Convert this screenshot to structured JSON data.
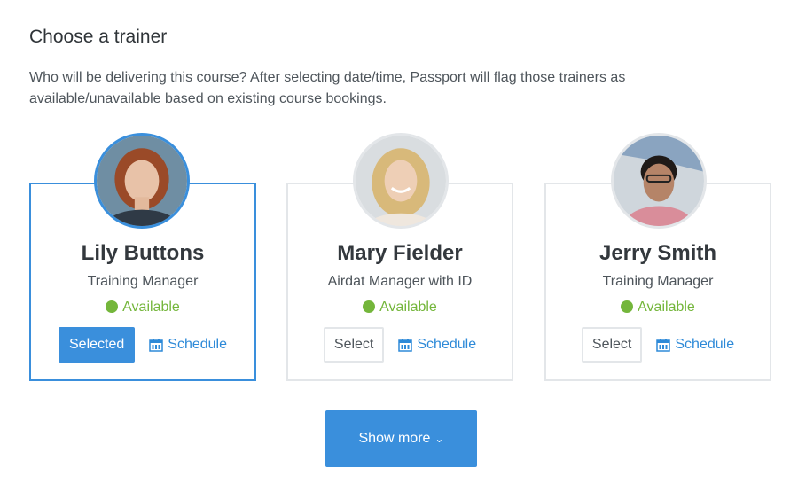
{
  "heading": "Choose a trainer",
  "description": "Who will be delivering this course? After selecting date/time, Passport will flag those trainers as available/unavailable based on existing course bookings.",
  "trainers": [
    {
      "name": "Lily Buttons",
      "role": "Training Manager",
      "status": "Available",
      "action_label": "Selected",
      "schedule_label": "Schedule",
      "selected": true
    },
    {
      "name": "Mary Fielder",
      "role": "Airdat Manager with ID",
      "status": "Available",
      "action_label": "Select",
      "schedule_label": "Schedule",
      "selected": false
    },
    {
      "name": "Jerry Smith",
      "role": "Training Manager",
      "status": "Available",
      "action_label": "Select",
      "schedule_label": "Schedule",
      "selected": false
    }
  ],
  "show_more_label": "Show more",
  "colors": {
    "accent": "#3a8fdc",
    "available": "#74b63b",
    "border": "#e3e6e9"
  },
  "icons": {
    "status": "dot-icon",
    "schedule": "calendar-icon",
    "show_more": "chevron-down-icon"
  }
}
